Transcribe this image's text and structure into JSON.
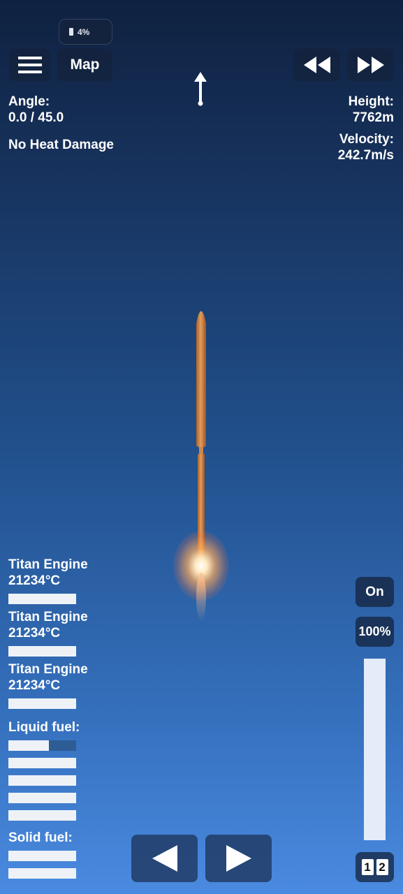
{
  "status": {
    "battery": "4%"
  },
  "toolbar": {
    "map_label": "Map"
  },
  "telemetry": {
    "angle_label": "Angle:",
    "angle_value": "0.0 / 45.0",
    "heat_status": "No Heat Damage",
    "height_label": "Height:",
    "height_value": "7762m",
    "velocity_label": "Velocity:",
    "velocity_value": "242.7m/s"
  },
  "engines": [
    {
      "name": "Titan Engine",
      "temp": "21234°C",
      "level": 1.0
    },
    {
      "name": "Titan Engine",
      "temp": "21234°C",
      "level": 1.0
    },
    {
      "name": "Titan Engine",
      "temp": "21234°C",
      "level": 1.0
    }
  ],
  "fuel": {
    "liquid_label": "Liquid fuel:",
    "liquid_levels": [
      0.6,
      1.0,
      1.0,
      1.0,
      1.0
    ],
    "solid_label": "Solid fuel:",
    "solid_levels": [
      1.0,
      1.0
    ]
  },
  "throttle": {
    "toggle_label": "On",
    "percent_label": "100%",
    "level": 1.0,
    "stage_labels": [
      "1",
      "2"
    ]
  },
  "colors": {
    "rocket_body": "#d48a4c",
    "bar_fill": "#eef2f7",
    "bar_empty": "#2e5c95"
  },
  "icons": [
    "battery-icon",
    "hamburger-menu-icon",
    "rewind-icon",
    "fast-forward-icon",
    "direction-arrow-icon",
    "rotate-left-icon",
    "rotate-right-icon"
  ]
}
